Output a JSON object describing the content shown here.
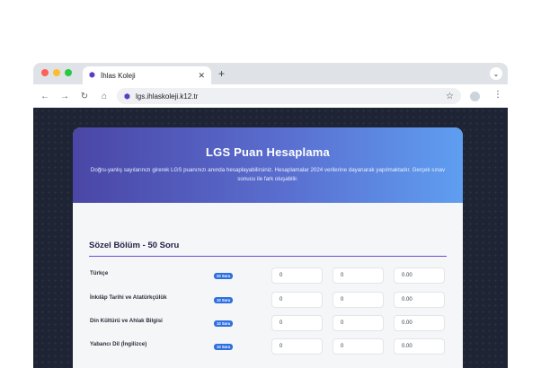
{
  "browser": {
    "tab_title": "İhlas Koleji",
    "url": "lgs.ihlaskoleji.k12.tr",
    "close_glyph": "✕",
    "newtab_glyph": "+",
    "back_glyph": "←",
    "forward_glyph": "→",
    "reload_glyph": "↻",
    "home_glyph": "⌂",
    "star_glyph": "☆",
    "kebab_glyph": "⋮",
    "chevron_glyph": "⌄",
    "traffic_colors": [
      "#ff5f57",
      "#febc2e",
      "#28c840"
    ]
  },
  "hero": {
    "title": "LGS Puan Hesaplama",
    "subtitle": "Doğru-yanlış sayılarınızı girerek LGS puanınızı anında hesaplayabilirsiniz. Hesaplamalar 2024 verilerine dayanarak yapılmaktadır. Gerçek sınav sonucu ile fark oluşabilir."
  },
  "section": {
    "title": "Sözel Bölüm - 50 Soru",
    "rows": [
      {
        "label": "Türkçe",
        "badge": "20 Soru",
        "dogru": "0",
        "yanlis": "0",
        "net": "0.00"
      },
      {
        "label": "İnkılâp Tarihi ve Atatürkçülük",
        "badge": "10 Soru",
        "dogru": "0",
        "yanlis": "0",
        "net": "0.00"
      },
      {
        "label": "Din Kültürü ve Ahlak Bilgisi",
        "badge": "10 Soru",
        "dogru": "0",
        "yanlis": "0",
        "net": "0.00"
      },
      {
        "label": "Yabancı Dil (İngilizce)",
        "badge": "10 Soru",
        "dogru": "0",
        "yanlis": "0",
        "net": "0.00"
      }
    ]
  },
  "colors": {
    "accent": "#6b4cd0",
    "badge": "#2f6fe0",
    "hero_start": "#4a46a6",
    "hero_end": "#5f9ef0"
  }
}
